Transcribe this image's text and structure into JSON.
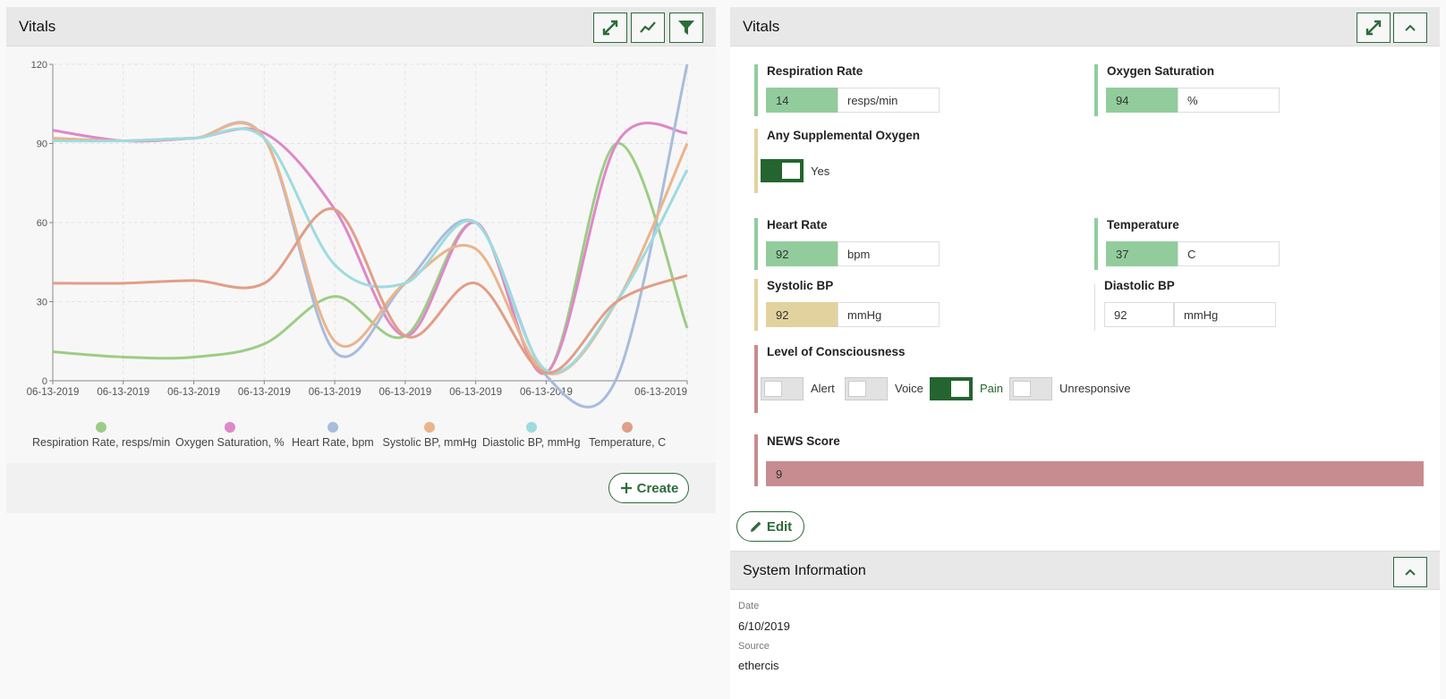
{
  "left_panel": {
    "title": "Vitals",
    "toolbar": {
      "expand_icon": "expand-icon",
      "trend_icon": "trend-line-icon",
      "filter_icon": "filter-icon"
    },
    "create_label": "Create"
  },
  "chart_data": {
    "type": "line",
    "x": [
      "06-13-2019",
      "06-13-2019",
      "06-13-2019",
      "06-13-2019",
      "06-13-2019",
      "06-13-2019",
      "06-13-2019",
      "06-13-2019",
      "06-13-2019",
      "06-13-2019"
    ],
    "x_tick_labels": [
      "06-13-2019",
      "06-13-2019",
      "06-13-2019",
      "06-13-2019",
      "06-13-2019",
      "06-13-2019",
      "06-13-2019",
      "06-13-2019",
      "06-13-2019"
    ],
    "ylim": [
      0,
      120
    ],
    "yticks": [
      0,
      30,
      60,
      90,
      120
    ],
    "grid": true,
    "legend_placement": "bottom",
    "series": [
      {
        "name": "Respiration Rate, resps/min",
        "color": "#9ccd86",
        "values": [
          11,
          9,
          9,
          14,
          32,
          17,
          60,
          3,
          90,
          20
        ]
      },
      {
        "name": "Oxygen Saturation, %",
        "color": "#de88c8",
        "values": [
          95,
          91,
          92,
          94,
          65,
          17,
          60,
          3,
          90,
          94
        ]
      },
      {
        "name": "Heart Rate, bpm",
        "color": "#a8bcdc",
        "values": [
          92,
          91,
          92,
          92,
          11,
          37,
          60,
          2,
          1,
          120
        ]
      },
      {
        "name": "Systolic BP, mmHg",
        "color": "#ebb48a",
        "values": [
          92,
          91,
          92,
          92,
          15,
          37,
          50,
          3,
          30,
          90
        ]
      },
      {
        "name": "Diastolic BP, mmHg",
        "color": "#9edbde",
        "values": [
          91,
          91,
          92,
          92,
          44,
          37,
          60,
          4,
          30,
          80
        ]
      },
      {
        "name": "Temperature, C",
        "color": "#e19e88",
        "values": [
          37,
          37,
          38,
          37,
          65,
          17,
          37,
          3,
          30,
          40
        ]
      }
    ]
  },
  "right_panel": {
    "title": "Vitals",
    "respiration": {
      "label": "Respiration Rate",
      "value": "14",
      "unit": "resps/min",
      "color": "#92cc9c"
    },
    "oxygen": {
      "label": "Oxygen Saturation",
      "value": "94",
      "unit": "%",
      "color": "#92cc9c"
    },
    "supplemental": {
      "label": "Any Supplemental Oxygen",
      "value": "Yes",
      "color": "#e2d29e"
    },
    "heart_rate": {
      "label": "Heart Rate",
      "value": "92",
      "unit": "bpm",
      "color": "#92cc9c"
    },
    "temperature": {
      "label": "Temperature",
      "value": "37",
      "unit": "C",
      "color": "#92cc9c"
    },
    "systolic": {
      "label": "Systolic BP",
      "value": "92",
      "unit": "mmHg",
      "color": "#e2d29e"
    },
    "diastolic": {
      "label": "Diastolic BP",
      "value": "92",
      "unit": "mmHg"
    },
    "consciousness": {
      "label": "Level of Consciousness",
      "color": "#c78c8f",
      "options": [
        {
          "label": "Alert",
          "selected": false
        },
        {
          "label": "Voice",
          "selected": false
        },
        {
          "label": "Pain",
          "selected": true
        },
        {
          "label": "Unresponsive",
          "selected": false
        }
      ]
    },
    "news": {
      "label": "NEWS Score",
      "value": "9",
      "color": "#c78c8f"
    },
    "edit_label": "Edit"
  },
  "system_info": {
    "title": "System Information",
    "date_label": "Date",
    "date_value": "6/10/2019",
    "source_label": "Source",
    "source_value": "ethercis"
  }
}
